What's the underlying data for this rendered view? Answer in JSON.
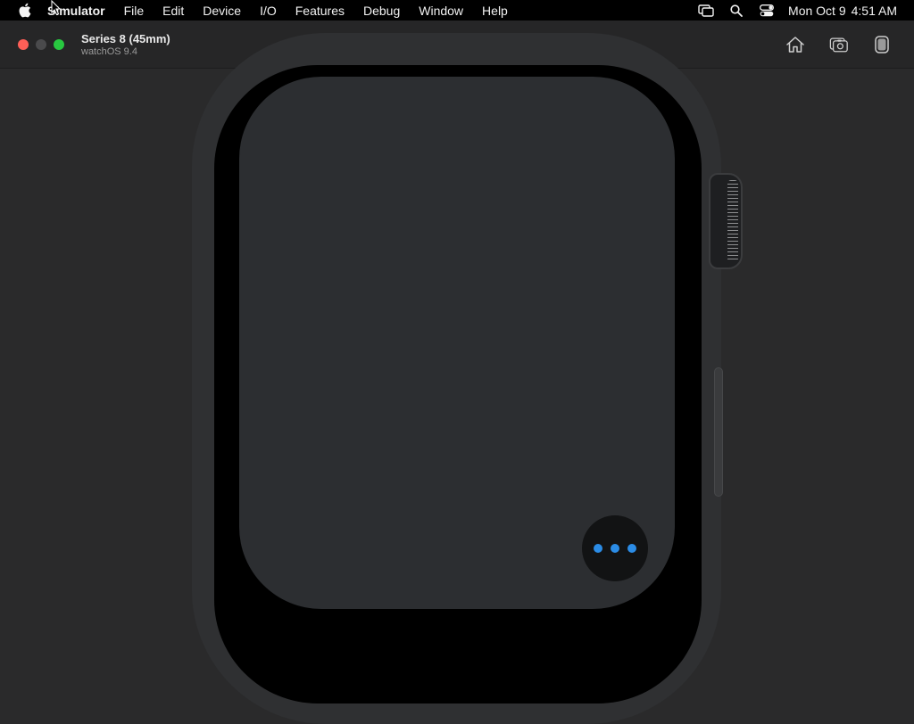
{
  "menubar": {
    "items": [
      "Simulator",
      "File",
      "Edit",
      "Device",
      "I/O",
      "Features",
      "Debug",
      "Window",
      "Help"
    ],
    "clock_date": "Mon Oct 9",
    "clock_time": "4:51 AM",
    "status_icons": [
      "screen-mirroring-icon",
      "search-icon",
      "control-center-icon"
    ]
  },
  "window": {
    "title": "Series 8 (45mm)",
    "subtitle": "watchOS 9.4",
    "toolbar_icons": [
      "home-icon",
      "screenshot-icon",
      "rotate-icon"
    ]
  },
  "watch": {
    "more_button_color": "#2b8ce6"
  },
  "colors": {
    "close": "#fe5f57",
    "minimize": "#4a4a4c",
    "zoom": "#28c840",
    "background": "#2a2a2b"
  }
}
